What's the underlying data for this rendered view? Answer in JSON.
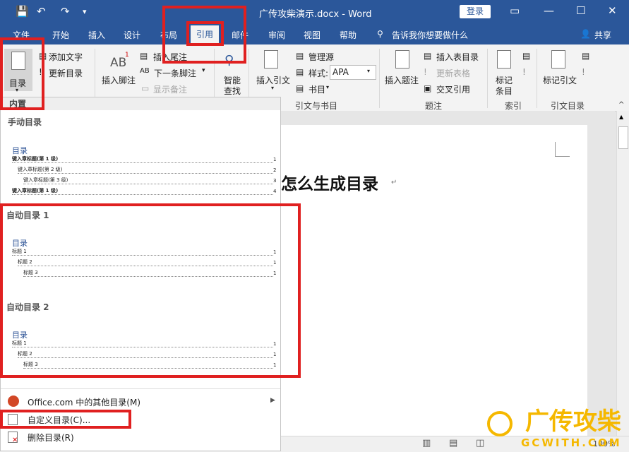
{
  "window": {
    "title": "广传攻柴演示.docx  -  Word",
    "login_button": "登录",
    "controls": {
      "ribbon_options": "▭",
      "minimize": "—",
      "maximize": "☐",
      "close": "✕"
    }
  },
  "quick_access": {
    "save_icon": "💾",
    "undo_icon": "↶",
    "redo_icon": "↷",
    "customize_icon": "▾"
  },
  "tabs": {
    "file": "文件",
    "home": "开始",
    "insert": "插入",
    "design": "设计",
    "layout": "布局",
    "references": "引用",
    "mailings": "邮件",
    "review": "审阅",
    "view": "视图",
    "help": "帮助"
  },
  "tell_me": "告诉我你想要做什么",
  "share": "共享",
  "ribbon": {
    "toc_button": "目录",
    "add_text": "添加文字",
    "update_toc": "更新目录",
    "insert_footnote": "插入脚注",
    "insert_endnote": "插入尾注",
    "next_footnote": "下一条脚注",
    "show_notes": "显示备注",
    "smart_lookup_line1": "智能",
    "smart_lookup_line2": "查找",
    "insert_citation": "插入引文",
    "manage_sources": "管理源",
    "style_label": "样式:",
    "style_value": "APA",
    "bibliography": "书目",
    "group_citations": "引文与书目",
    "insert_caption": "插入题注",
    "insert_table_of_figures": "插入表目录",
    "update_table": "更新表格",
    "cross_reference": "交叉引用",
    "group_captions": "题注",
    "mark_entry_line1": "标记",
    "mark_entry_line2": "条目",
    "group_index": "索引",
    "mark_citation": "标记引文",
    "group_toa": "引文目录"
  },
  "dropdown": {
    "section_builtin": "内置",
    "manual": {
      "heading": "手动目录",
      "toc_title": "目录",
      "lines": [
        {
          "text": "键入章标题(第 1 级)",
          "page": "1"
        },
        {
          "text": "键入章标题(第 2 级)",
          "page": "2"
        },
        {
          "text": "键入章标题(第 3 级)",
          "page": "3"
        },
        {
          "text": "键入章标题(第 1 级)",
          "page": "4"
        }
      ]
    },
    "auto1": {
      "heading": "自动目录 1",
      "toc_title": "目录",
      "lines": [
        {
          "text": "标题 1",
          "page": "1"
        },
        {
          "text": "标题 2",
          "page": "1"
        },
        {
          "text": "标题 3",
          "page": "1"
        }
      ]
    },
    "auto2": {
      "heading": "自动目录 2",
      "toc_title": "目录",
      "lines": [
        {
          "text": "标题 1",
          "page": "1"
        },
        {
          "text": "标题 2",
          "page": "1"
        },
        {
          "text": "标题 3",
          "page": "1"
        }
      ]
    },
    "menu": {
      "more_office": "Office.com 中的其他目录(M)",
      "custom": "自定义目录(C)...",
      "remove": "删除目录(R)"
    }
  },
  "document": {
    "heading": "怎么生成目录"
  },
  "status": {
    "zoom": "100%"
  },
  "watermark": {
    "line1": "广传攻柴",
    "line2": "GCWITH.COM"
  },
  "colors": {
    "accent": "#2b579a",
    "annotation": "#e02020",
    "watermark": "#f5b800"
  }
}
